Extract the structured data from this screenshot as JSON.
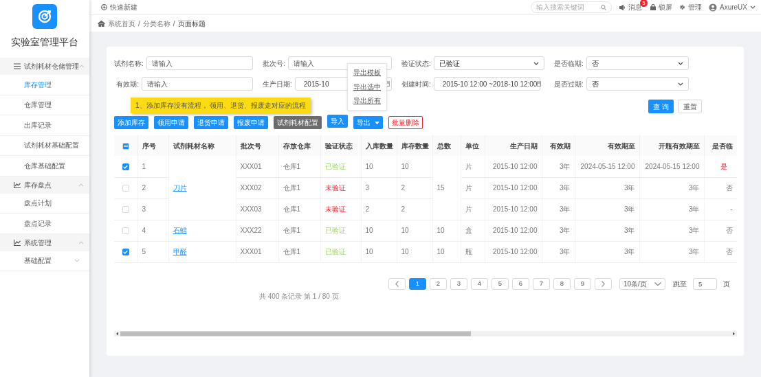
{
  "sidebar": {
    "title": "实验室管理平台",
    "sections": [
      {
        "label": "试剂耗材仓储管理",
        "kind": "list",
        "expanded": true,
        "items": [
          {
            "label": "库存管理",
            "selected": true,
            "kind": "link"
          },
          {
            "label": "仓库管理",
            "selected": false,
            "kind": "link"
          },
          {
            "label": "出库记录",
            "selected": false,
            "kind": "link"
          },
          {
            "label": "试剂耗材基础配置",
            "selected": false,
            "kind": "link"
          },
          {
            "label": "仓库基础配置",
            "selected": false,
            "kind": "link"
          }
        ]
      },
      {
        "label": "库存盘点",
        "kind": "chart",
        "expanded": true,
        "items": [
          {
            "label": "盘点计划",
            "selected": false,
            "kind": "link"
          },
          {
            "label": "盘点记录",
            "selected": false,
            "kind": "link"
          }
        ]
      },
      {
        "label": "系统管理",
        "kind": "chart",
        "expanded": true,
        "items": [
          {
            "label": "基础配置",
            "selected": false,
            "kind": "submenu"
          }
        ]
      }
    ]
  },
  "topbar": {
    "quick_new": "快速新建",
    "search_placeholder": "输入搜索关键词",
    "messages": {
      "label": "消息",
      "badge": "5"
    },
    "lock": "锁屏",
    "admin": "管理",
    "user": "AxureUX"
  },
  "breadcrumb": {
    "separator": "/",
    "items": [
      "系统首页",
      "分类名称",
      "页面标题"
    ]
  },
  "filters": [
    {
      "label": "试剂名称:",
      "kind": "text",
      "placeholder": "请输入"
    },
    {
      "label": "批次号:",
      "kind": "text",
      "placeholder": "请输入"
    },
    {
      "label": "验证状态:",
      "kind": "select",
      "value": "已验证"
    },
    {
      "label": "是否临期:",
      "kind": "select",
      "value": "否"
    },
    {
      "label": "有效期:",
      "kind": "text",
      "placeholder": "请输入"
    },
    {
      "label": "生产日期:",
      "kind": "date",
      "value": "2015-10"
    },
    {
      "label": "创建时间:",
      "kind": "date",
      "value": "2015-10 12:00 ~2018-10 12:00"
    },
    {
      "label": "是否过期:",
      "kind": "select",
      "value": "否"
    }
  ],
  "note": "1、添加库存没有流程， 领用、退货、报废走对应的流程",
  "query_button": "查 询",
  "reset_button": "重置",
  "toolbar": [
    {
      "label": "添加库存",
      "kind": "primary"
    },
    {
      "label": "领用申请",
      "kind": "primary"
    },
    {
      "label": "退货申请",
      "kind": "primary"
    },
    {
      "label": "报废申请",
      "kind": "primary"
    },
    {
      "label": "试剂耗材配置",
      "kind": "secondary"
    },
    {
      "label": "导入",
      "kind": "primary"
    },
    {
      "label": "导出",
      "kind": "dropdown",
      "open": true,
      "menu": [
        "导出模板",
        "导出选中",
        "导出所有"
      ]
    },
    {
      "label": "批量删除",
      "kind": "danger"
    }
  ],
  "table": {
    "header_checkbox": {
      "indeterminate": true
    },
    "columns": [
      "序号",
      "试剂耗材名称",
      "批次号",
      "存放仓库",
      "验证状态",
      "入库数量",
      "库存数量",
      "总数",
      "单位",
      "生产日期",
      "有效期",
      "有效期至",
      "开瓶有效期至",
      "是否临"
    ],
    "groups": [
      {
        "name": "刀片",
        "total": "15",
        "rows": [
          {
            "checked": true,
            "index": "1",
            "batch": "XXX01",
            "warehouse": "仓库1",
            "status": {
              "text": "已验证",
              "kind": "verified"
            },
            "in_qty": "10",
            "stock_qty": "10",
            "unit": "片",
            "production_date": "2015-10 12:00",
            "validity": "3年",
            "valid_until": "2024-05-15 12:00",
            "opened_valid_until": "2024-05-15 12:00",
            "near_expiry": {
              "text": "是",
              "alert": true
            }
          },
          {
            "checked": false,
            "index": "2",
            "batch": "XXX02",
            "warehouse": "仓库1",
            "status": {
              "text": "未验证",
              "kind": "unverified"
            },
            "in_qty": "3",
            "stock_qty": "2",
            "unit": "片",
            "production_date": "2015-10 12:00",
            "validity": "3年",
            "valid_until": "3年",
            "opened_valid_until": "3年",
            "near_expiry": {
              "text": "否",
              "alert": false
            }
          },
          {
            "checked": false,
            "index": "3",
            "batch": "XXX03",
            "warehouse": "仓库1",
            "status": {
              "text": "未验证",
              "kind": "unverified"
            },
            "in_qty": "2",
            "stock_qty": "2",
            "unit": "片",
            "production_date": "2015-10 12:00",
            "validity": "3年",
            "valid_until": "3年",
            "opened_valid_until": "3年",
            "near_expiry": {
              "text": "-",
              "alert": false
            }
          }
        ]
      },
      {
        "name": "石蜡",
        "total": "10",
        "rows": [
          {
            "checked": false,
            "index": "4",
            "batch": "XXX22",
            "warehouse": "仓库1",
            "status": {
              "text": "已验证",
              "kind": "verified"
            },
            "in_qty": "10",
            "stock_qty": "10",
            "unit": "盒",
            "production_date": "2015-10 12:00",
            "validity": "3年",
            "valid_until": "3年",
            "opened_valid_until": "3年",
            "near_expiry": {
              "text": "否",
              "alert": false
            }
          }
        ]
      },
      {
        "name": "甲醛",
        "total": "10",
        "rows": [
          {
            "checked": true,
            "index": "5",
            "batch": "XXX01",
            "warehouse": "仓库1",
            "status": {
              "text": "已验证",
              "kind": "verified"
            },
            "in_qty": "10",
            "stock_qty": "10",
            "unit": "瓶",
            "production_date": "2015-10 12:00",
            "validity": "3年",
            "valid_until": "3年",
            "opened_valid_until": "3年",
            "near_expiry": {
              "text": "否",
              "alert": false
            }
          }
        ]
      }
    ]
  },
  "pagination": {
    "summary": "共 400 条记录 第 1 / 80 页",
    "pages": [
      {
        "label": "1",
        "selected": true
      },
      {
        "label": "2",
        "selected": false
      },
      {
        "label": "3",
        "selected": false
      },
      {
        "label": "4",
        "selected": false
      },
      {
        "label": "5",
        "selected": false
      },
      {
        "label": "6",
        "selected": false
      },
      {
        "label": "7",
        "selected": false
      },
      {
        "label": "8",
        "selected": false
      },
      {
        "label": "9",
        "selected": false
      }
    ],
    "page_size": "10条/页",
    "jump_label": "跳至",
    "jump_value": "5",
    "page_suffix": "页"
  }
}
